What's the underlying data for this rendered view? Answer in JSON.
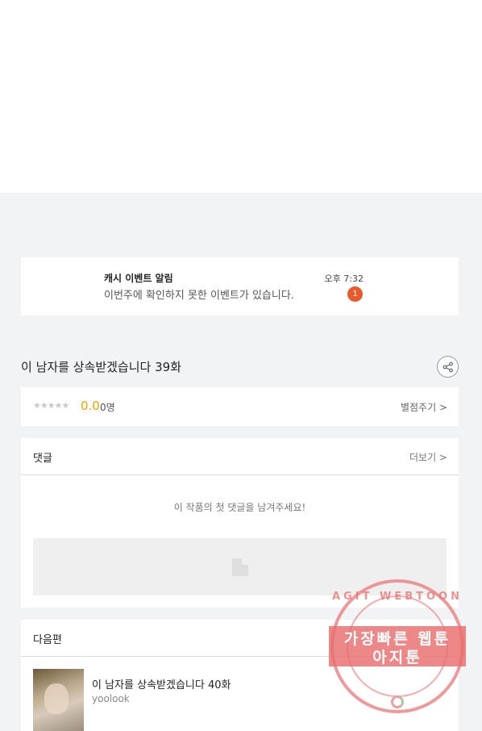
{
  "notification": {
    "title": "캐시 이벤트 알림",
    "message": "이번주에 확인하지 못한 이벤트가 있습니다.",
    "time": "오후 7:32",
    "badge_count": "1"
  },
  "episode": {
    "title": "이 남자를 상속받겠습니다 39화"
  },
  "rating": {
    "stars": "★★★★★",
    "score": "0.0",
    "count": "0명",
    "rate_link": "별점주기 >"
  },
  "comments": {
    "label": "댓글",
    "more": "더보기 >",
    "empty_message": "이 작품의 첫 댓글을 남겨주세요!"
  },
  "next_episode": {
    "label": "다음편",
    "title": "이 남자를 상속받겠습니다 40화",
    "author": "yoolook"
  },
  "watermark": {
    "top_text": "AGIT WEBTOON",
    "line1": "가장빠른 웹툰",
    "line2": "아지툰"
  },
  "colors": {
    "badge": "#e8592c",
    "score": "#f0a500",
    "background": "#f2f3f5"
  }
}
